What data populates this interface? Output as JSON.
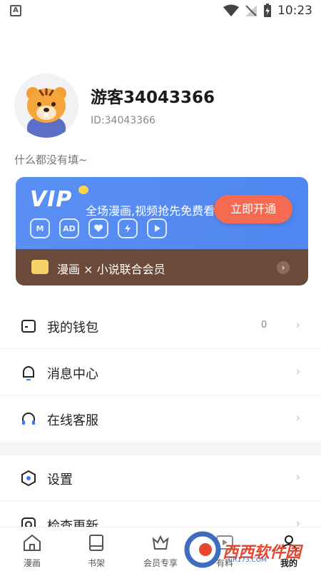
{
  "status_bar": {
    "time": "10:23"
  },
  "profile": {
    "username": "游客34043366",
    "user_id": "ID:34043366",
    "bio": "什么都没有填~"
  },
  "vip": {
    "logo": "VIP",
    "description": "全场漫画,视频抢先免费看",
    "button_label": "立即开通",
    "benefit_icons": [
      "M",
      "AD",
      "heart-icon",
      "lightning-icon",
      "play-icon"
    ],
    "union_text": "漫画 × 小说联合会员",
    "colors": {
      "card": "#4f86ef",
      "button": "#f76a52",
      "union_bar": "#6b4a3a"
    }
  },
  "menu": [
    {
      "label": "我的钱包",
      "count": "0",
      "icon": "wallet-icon"
    },
    {
      "label": "消息中心",
      "icon": "bell-icon"
    },
    {
      "label": "在线客服",
      "icon": "headset-icon"
    },
    {
      "label": "设置",
      "icon": "settings-icon"
    },
    {
      "label": "检查更新",
      "icon": "update-icon"
    }
  ],
  "bottom_nav": [
    {
      "label": "漫画",
      "icon": "home-icon"
    },
    {
      "label": "书架",
      "icon": "bookshelf-icon"
    },
    {
      "label": "会员专享",
      "icon": "crown-icon"
    },
    {
      "label": "有料",
      "icon": "play-icon"
    },
    {
      "label": "我的",
      "icon": "profile-icon",
      "active": true
    }
  ],
  "watermark": {
    "text": "西西软件园",
    "site": "CR173.COM"
  }
}
